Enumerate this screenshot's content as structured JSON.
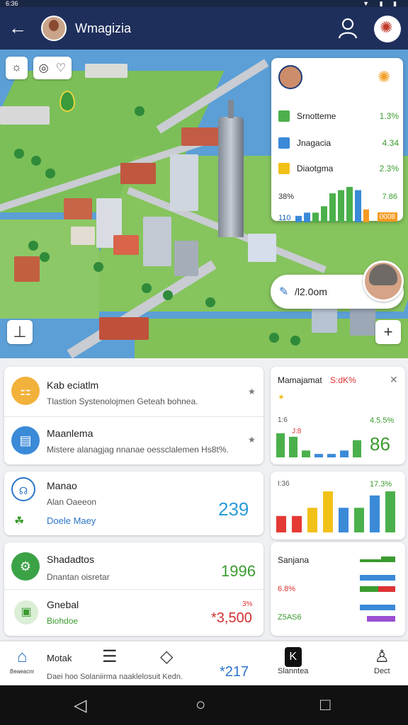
{
  "status": {
    "time": "6:36",
    "right": "▼ ▮ ▮"
  },
  "appbar": {
    "title": "Wmagizia"
  },
  "map": {
    "tool_icons": [
      "sun-icon",
      "target-icon",
      "heart-icon"
    ],
    "overlay": {
      "rows": [
        {
          "label": "Srnotteme",
          "value": "1.3%",
          "color": "#4bb04b"
        },
        {
          "label": "Jnagacia",
          "value": "4.34",
          "color": "#3a8ad8"
        },
        {
          "label": "Diaotgma",
          "value": "2.3%",
          "color": "#f2c118"
        }
      ],
      "left_top": "38%",
      "left_bottom": "110",
      "right_top": "7.86",
      "right_tag": "0008",
      "bars": [
        2,
        3,
        3,
        5,
        9,
        10,
        11,
        10,
        4
      ]
    },
    "chip_text": "/l2.0om"
  },
  "cards": {
    "kab": {
      "title": "Kab eciatlm",
      "sub": "Tlastion Systenolojmen Geteah bohnea."
    },
    "manajema": {
      "title": "Maanlema",
      "sub": "Mistere alanagjag nnanae oessclalemen Hs8t%."
    },
    "manao": {
      "title": "Manao",
      "sub": "Alan Oaeeon",
      "link": "Doele Maey",
      "value": "239"
    },
    "shada": {
      "title": "Shadadtos",
      "sub": "Dnantan oisretar",
      "value": "1996"
    },
    "global": {
      "title": "Gnebal",
      "badge": "Biohdoe",
      "pct": "3%",
      "value": "*3,500"
    },
    "manajamat": {
      "title": "Mamajamat",
      "title_extra": "S:dK%",
      "left_label": "1:6",
      "right_label": "4.5.5%",
      "sub_left": "J:8",
      "value": "86",
      "bars": [
        7,
        6,
        2,
        1,
        1,
        2,
        5
      ]
    },
    "panel2": {
      "left_label": "I:36",
      "right_label": "17.3%",
      "bars": [
        4,
        4,
        6,
        10,
        6,
        6,
        9,
        10
      ]
    },
    "sanjana": {
      "title": "Sanjana",
      "value_a": "6.8%",
      "value_b": "Z5AS6"
    }
  },
  "bottom": {
    "items": [
      {
        "label": "Beaeacnr",
        "icon": "home-icon"
      },
      {
        "label": "",
        "icon": "document-icon"
      },
      {
        "label": "",
        "icon": "tag-icon"
      },
      {
        "label": "Slanntea",
        "icon": "k-app-icon"
      },
      {
        "label": "Dect",
        "icon": "profile-icon"
      }
    ],
    "mota": "Motak",
    "sub": "Daei hoo   Solaniirma naaklelosuit Kedn.",
    "value": "*217"
  }
}
